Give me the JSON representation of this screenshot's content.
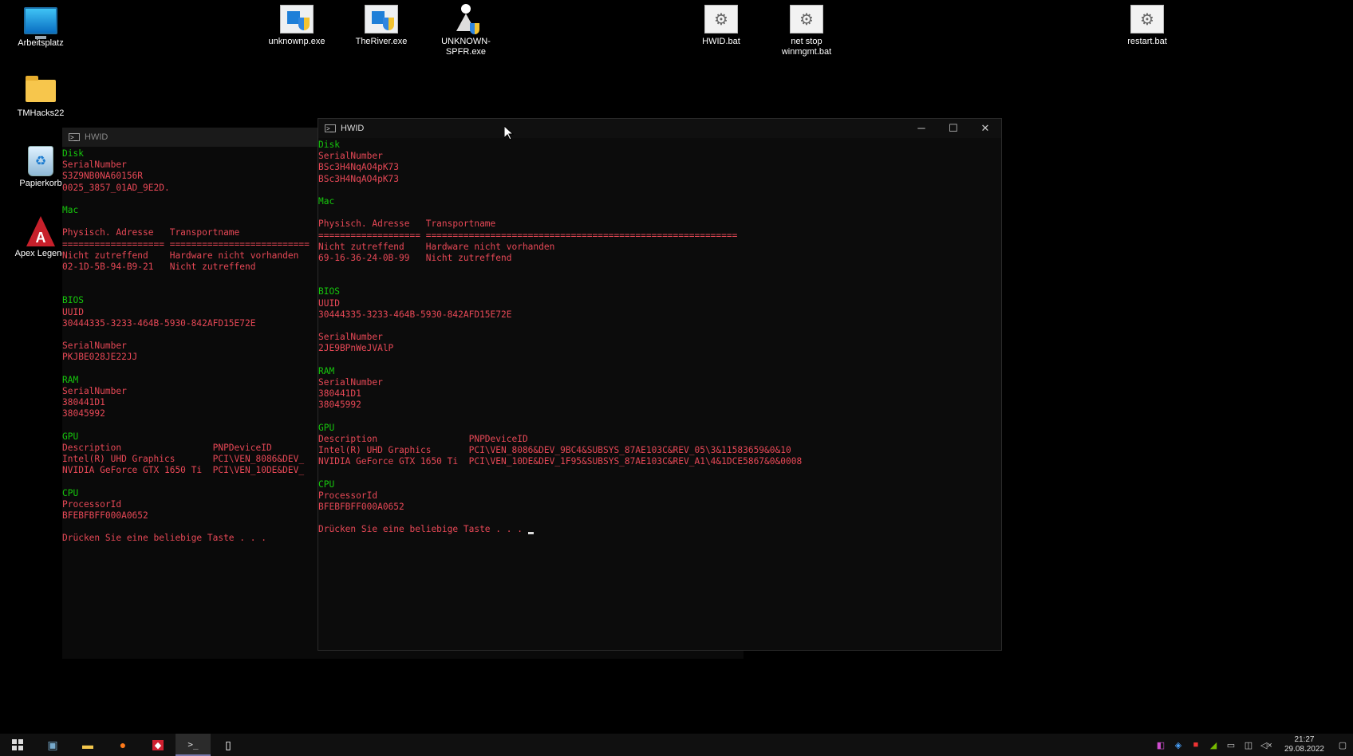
{
  "desktop": {
    "icons": [
      {
        "label": "Arbeitsplatz",
        "icon": "computer-icon"
      },
      {
        "label": "TMHacks22",
        "icon": "folder-icon"
      },
      {
        "label": "Papierkorb",
        "icon": "recycle-bin-icon"
      },
      {
        "label": "Apex Legend",
        "icon": "apex-legends-icon"
      },
      {
        "label": "unknownp.exe",
        "icon": "exe-shield-icon"
      },
      {
        "label": "TheRiver.exe",
        "icon": "exe-shield-icon"
      },
      {
        "label": "UNKNOWN-SPFR.exe",
        "icon": "spfr-shield-icon"
      },
      {
        "label": "HWID.bat",
        "icon": "batch-file-icon"
      },
      {
        "label": "net stop\nwinmgmt.bat",
        "icon": "batch-file-icon"
      },
      {
        "label": "restart.bat",
        "icon": "batch-file-icon"
      }
    ]
  },
  "back_window": {
    "title": "HWID",
    "lines": [
      {
        "t": "Disk",
        "c": "g"
      },
      {
        "t": "SerialNumber",
        "c": "r"
      },
      {
        "t": "S3Z9NB0NA60156R",
        "c": "r"
      },
      {
        "t": "0025_3857_01AD_9E2D.",
        "c": "r"
      },
      {
        "t": "",
        "c": "r"
      },
      {
        "t": "Mac",
        "c": "g"
      },
      {
        "t": "",
        "c": "r"
      },
      {
        "t": "Physisch. Adresse   Transportname",
        "c": "r"
      },
      {
        "t": "=================== ==========================",
        "c": "r"
      },
      {
        "t": "Nicht zutreffend    Hardware nicht vorhanden",
        "c": "r"
      },
      {
        "t": "02-1D-5B-94-B9-21   Nicht zutreffend",
        "c": "r"
      },
      {
        "t": "",
        "c": "r"
      },
      {
        "t": "",
        "c": "r"
      },
      {
        "t": "BIOS",
        "c": "g"
      },
      {
        "t": "UUID",
        "c": "r"
      },
      {
        "t": "30444335-3233-464B-5930-842AFD15E72E",
        "c": "r"
      },
      {
        "t": "",
        "c": "r"
      },
      {
        "t": "SerialNumber",
        "c": "r"
      },
      {
        "t": "PKJBE028JE22JJ",
        "c": "r"
      },
      {
        "t": "",
        "c": "r"
      },
      {
        "t": "RAM",
        "c": "g"
      },
      {
        "t": "SerialNumber",
        "c": "r"
      },
      {
        "t": "380441D1",
        "c": "r"
      },
      {
        "t": "38045992",
        "c": "r"
      },
      {
        "t": "",
        "c": "r"
      },
      {
        "t": "GPU",
        "c": "g"
      },
      {
        "t": "Description                 PNPDeviceID",
        "c": "r"
      },
      {
        "t": "Intel(R) UHD Graphics       PCI\\VEN_8086&DEV_",
        "c": "r"
      },
      {
        "t": "NVIDIA GeForce GTX 1650 Ti  PCI\\VEN_10DE&DEV_",
        "c": "r"
      },
      {
        "t": "",
        "c": "r"
      },
      {
        "t": "CPU",
        "c": "g"
      },
      {
        "t": "ProcessorId",
        "c": "r"
      },
      {
        "t": "BFEBFBFF000A0652",
        "c": "r"
      },
      {
        "t": "",
        "c": "r"
      },
      {
        "t": "Drücken Sie eine beliebige Taste . . .",
        "c": "r"
      }
    ]
  },
  "front_window": {
    "title": "HWID",
    "controls": {
      "minimize": "─",
      "maximize": "☐",
      "close": "✕"
    },
    "lines": [
      {
        "t": "Disk",
        "c": "g"
      },
      {
        "t": "SerialNumber",
        "c": "r"
      },
      {
        "t": "BSc3H4NqAO4pK73",
        "c": "r"
      },
      {
        "t": "BSc3H4NqAO4pK73",
        "c": "r"
      },
      {
        "t": "",
        "c": "r"
      },
      {
        "t": "Mac",
        "c": "g"
      },
      {
        "t": "",
        "c": "r"
      },
      {
        "t": "Physisch. Adresse   Transportname",
        "c": "r"
      },
      {
        "t": "=================== ==========================================================",
        "c": "r"
      },
      {
        "t": "Nicht zutreffend    Hardware nicht vorhanden",
        "c": "r"
      },
      {
        "t": "69-16-36-24-0B-99   Nicht zutreffend",
        "c": "r"
      },
      {
        "t": "",
        "c": "r"
      },
      {
        "t": "",
        "c": "r"
      },
      {
        "t": "BIOS",
        "c": "g"
      },
      {
        "t": "UUID",
        "c": "r"
      },
      {
        "t": "30444335-3233-464B-5930-842AFD15E72E",
        "c": "r"
      },
      {
        "t": "",
        "c": "r"
      },
      {
        "t": "SerialNumber",
        "c": "r"
      },
      {
        "t": "2JE9BPnWeJVAlP",
        "c": "r"
      },
      {
        "t": "",
        "c": "r"
      },
      {
        "t": "RAM",
        "c": "g"
      },
      {
        "t": "SerialNumber",
        "c": "r"
      },
      {
        "t": "380441D1",
        "c": "r"
      },
      {
        "t": "38045992",
        "c": "r"
      },
      {
        "t": "",
        "c": "r"
      },
      {
        "t": "GPU",
        "c": "g"
      },
      {
        "t": "Description                 PNPDeviceID",
        "c": "r"
      },
      {
        "t": "Intel(R) UHD Graphics       PCI\\VEN_8086&DEV_9BC4&SUBSYS_87AE103C&REV_05\\3&11583659&0&10",
        "c": "r"
      },
      {
        "t": "NVIDIA GeForce GTX 1650 Ti  PCI\\VEN_10DE&DEV_1F95&SUBSYS_87AE103C&REV_A1\\4&1DCE5867&0&0008",
        "c": "r"
      },
      {
        "t": "",
        "c": "r"
      },
      {
        "t": "CPU",
        "c": "g"
      },
      {
        "t": "ProcessorId",
        "c": "r"
      },
      {
        "t": "BFEBFBFF000A0652",
        "c": "r"
      },
      {
        "t": "",
        "c": "r"
      },
      {
        "t": "Drücken Sie eine beliebige Taste . . . ",
        "c": "r"
      }
    ]
  },
  "taskbar": {
    "items": [
      {
        "name": "start-button",
        "icon": "windows-icon"
      },
      {
        "name": "taskbar-app-1",
        "icon": "terminal-app-icon"
      },
      {
        "name": "taskbar-file-explorer",
        "icon": "folder-icon"
      },
      {
        "name": "taskbar-firefox",
        "icon": "firefox-icon"
      },
      {
        "name": "taskbar-app-red",
        "icon": "red-app-icon"
      },
      {
        "name": "taskbar-terminal",
        "icon": "terminal-icon"
      },
      {
        "name": "taskbar-notepad",
        "icon": "document-icon"
      }
    ],
    "clock_time": "21:27",
    "clock_date": "29.08.2022"
  },
  "colors": {
    "console_green": "#16c60c",
    "console_red": "#e74856",
    "background": "#000000"
  }
}
